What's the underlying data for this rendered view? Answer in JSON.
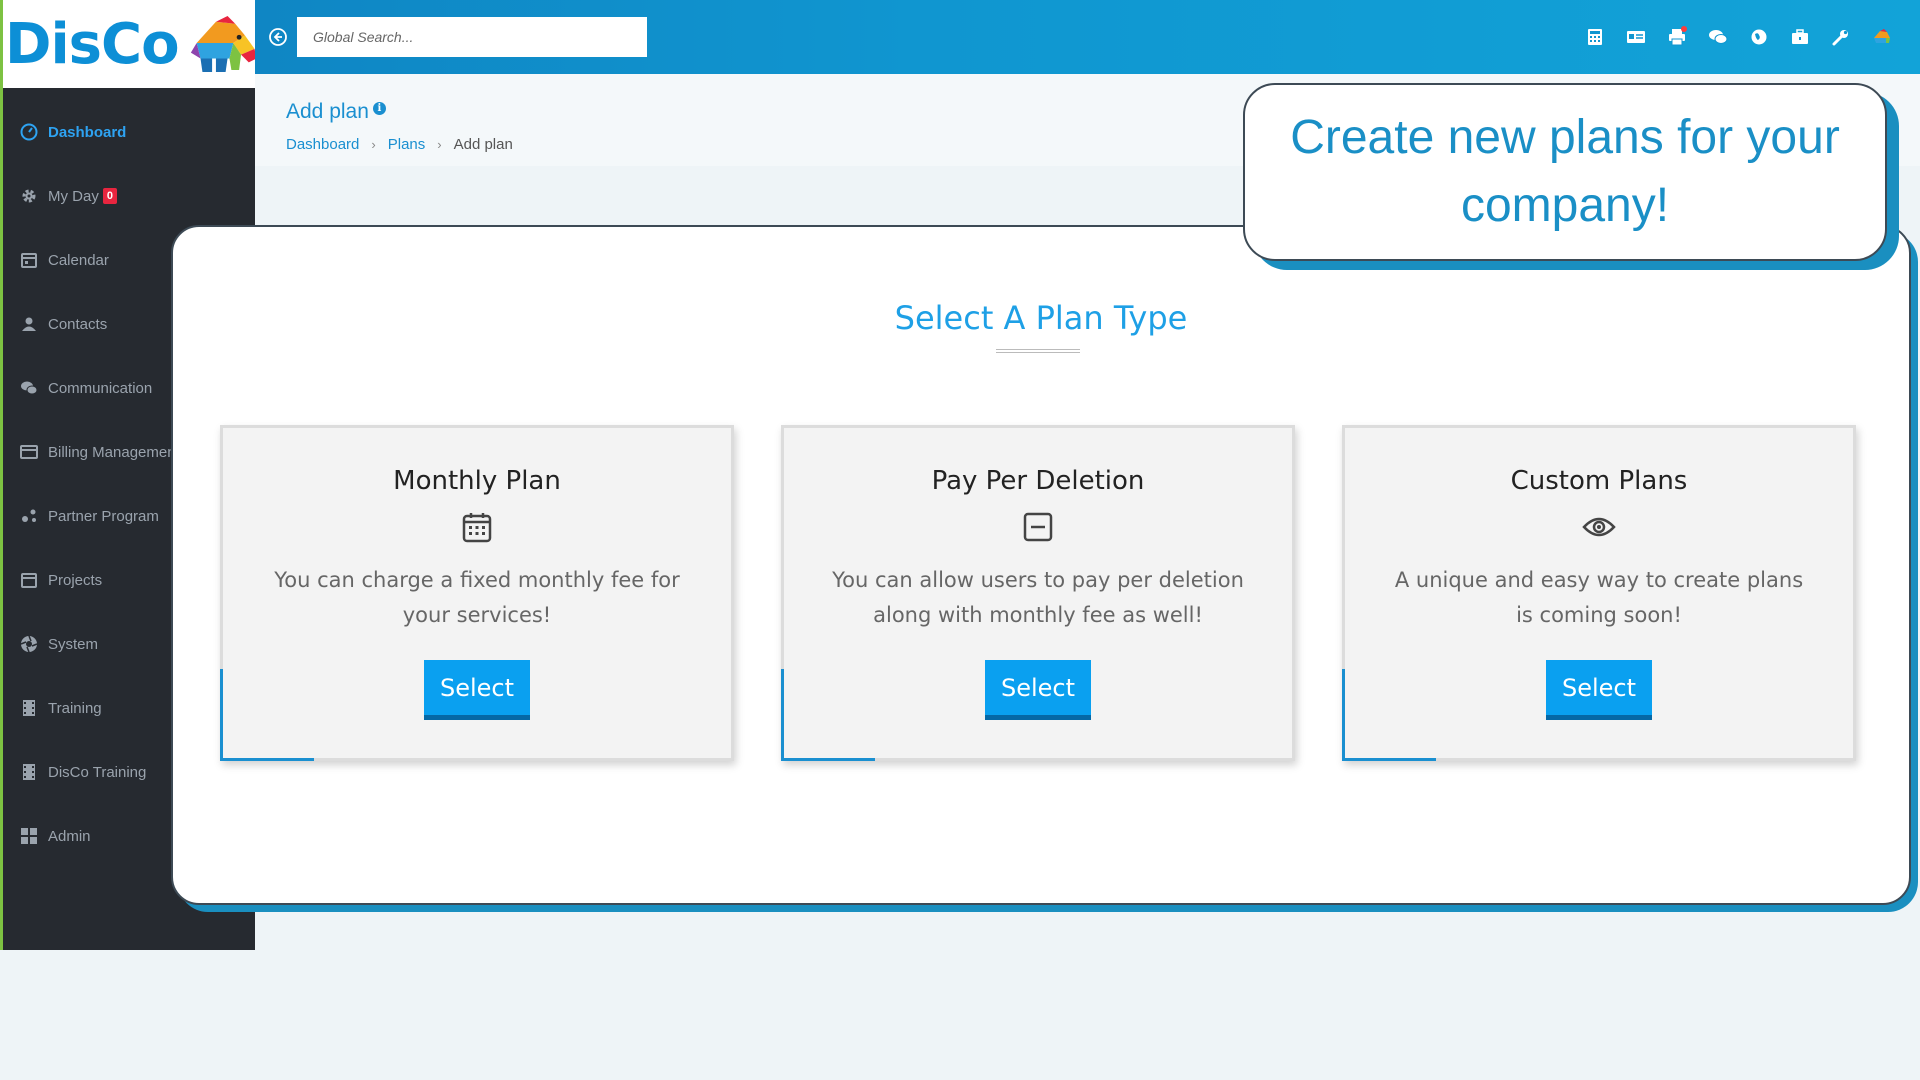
{
  "app": {
    "logo_text": "DisCo"
  },
  "sidebar": {
    "items": [
      {
        "label": "Dashboard",
        "icon": "dashboard-icon"
      },
      {
        "label": "My Day",
        "icon": "gear-icon",
        "badge": "0"
      },
      {
        "label": "Calendar",
        "icon": "calendar-icon"
      },
      {
        "label": "Contacts",
        "icon": "user-icon"
      },
      {
        "label": "Communication",
        "icon": "chat-icon"
      },
      {
        "label": "Billing Management",
        "icon": "credit-card-icon"
      },
      {
        "label": "Partner Program",
        "icon": "share-icon"
      },
      {
        "label": "Projects",
        "icon": "calendar-icon"
      },
      {
        "label": "System",
        "icon": "aperture-icon"
      },
      {
        "label": "Training",
        "icon": "film-icon"
      },
      {
        "label": "DisCo Training",
        "icon": "film-icon"
      },
      {
        "label": "Admin",
        "icon": "grid-icon"
      }
    ]
  },
  "topbar": {
    "search_placeholder": "Global Search...",
    "icons": [
      "calculator-icon",
      "id-card-icon",
      "printer-icon",
      "comments-icon",
      "globe-icon",
      "briefcase-icon",
      "wrench-icon",
      "avatar-icon"
    ]
  },
  "page": {
    "title": "Add plan",
    "breadcrumb": [
      "Dashboard",
      "Plans",
      "Add plan"
    ]
  },
  "main": {
    "section_title": "Select A Plan Type",
    "plans": [
      {
        "title": "Monthly Plan",
        "icon": "calendar-icon",
        "description": "You can charge a fixed monthly fee for your services!",
        "button": "Select"
      },
      {
        "title": "Pay Per Deletion",
        "icon": "minus-square-icon",
        "description": "You can allow users to pay per deletion along with monthly fee as well!",
        "button": "Select"
      },
      {
        "title": "Custom Plans",
        "icon": "eye-icon",
        "description": "A unique and easy way to create plans is coming soon!",
        "button": "Select"
      }
    ]
  },
  "callout": {
    "text": "Create new plans for your company!"
  },
  "colors": {
    "accent": "#1a8fd0",
    "sidebar_bg": "#262a30",
    "button": "#0aa0f0",
    "badge": "#e8253f"
  }
}
